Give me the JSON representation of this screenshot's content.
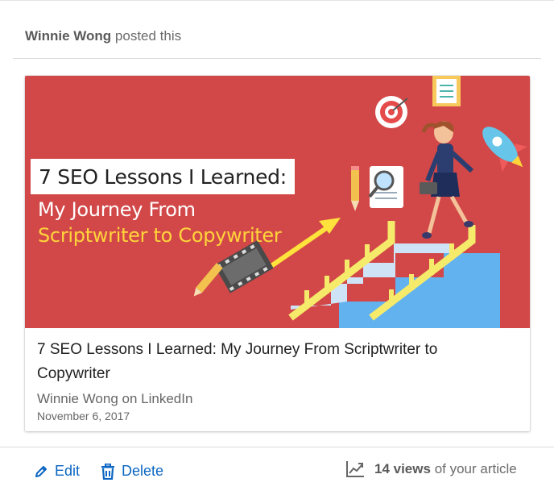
{
  "post": {
    "author": "Winnie Wong",
    "posted_label": "posted this"
  },
  "banner": {
    "title": "7 SEO Lessons I Learned:",
    "subtitle_line1": "My Journey From",
    "subtitle_line2": "Scriptwriter to Copywriter",
    "colors": {
      "background": "#d24848",
      "accent": "#ffd43b"
    }
  },
  "article": {
    "title": "7 SEO Lessons I Learned: My Journey From Scriptwriter to Copywriter",
    "source": "Winnie Wong on LinkedIn",
    "date": "November 6, 2017"
  },
  "actions": {
    "edit_label": "Edit",
    "delete_label": "Delete",
    "edit_icon": "pencil-icon",
    "delete_icon": "trash-icon"
  },
  "stats": {
    "views_count": "14 views",
    "views_suffix": "of your article",
    "icon": "trend-chart-icon"
  },
  "colors": {
    "link": "#0a66c2"
  }
}
